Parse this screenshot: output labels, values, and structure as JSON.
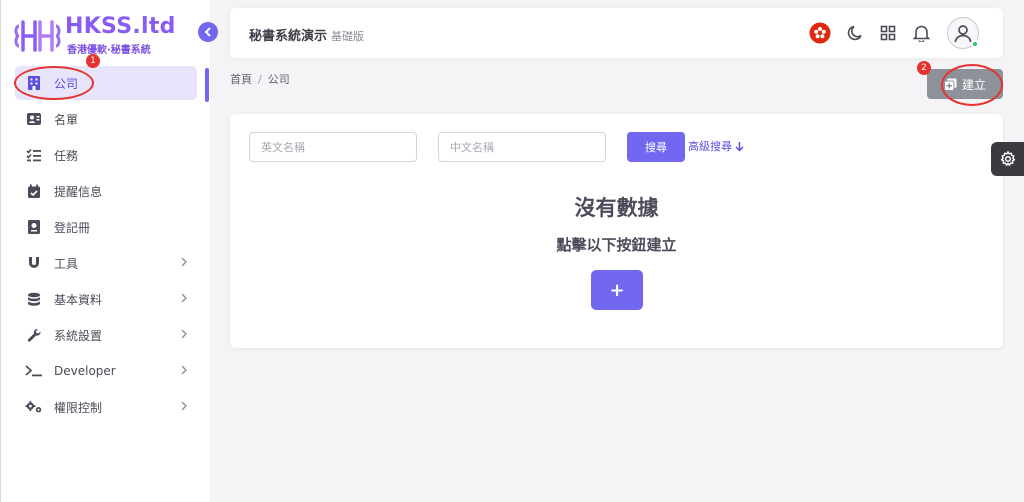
{
  "brand": {
    "title": "HKSS.ltd",
    "subtitle": "香港優軟·秘書系統",
    "primary": "#7367f0",
    "logo_color": "#8a5cf5"
  },
  "sidebar": {
    "items": [
      {
        "label": "公司",
        "icon": "building-icon",
        "active": true
      },
      {
        "label": "名單",
        "icon": "contact-card-icon"
      },
      {
        "label": "任務",
        "icon": "checklist-icon"
      },
      {
        "label": "提醒信息",
        "icon": "calendar-check-icon"
      },
      {
        "label": "登記冊",
        "icon": "register-book-icon"
      },
      {
        "label": "工具",
        "icon": "magnet-icon",
        "has_children": true
      },
      {
        "label": "基本資料",
        "icon": "database-icon",
        "has_children": true
      },
      {
        "label": "系統設置",
        "icon": "wrench-icon",
        "has_children": true
      },
      {
        "label": "Developer",
        "icon": "terminal-icon",
        "has_children": true
      },
      {
        "label": "權限控制",
        "icon": "gears-icon",
        "has_children": true
      }
    ]
  },
  "header": {
    "title": "秘書系統演示",
    "edition": "基礎版",
    "icons": [
      "hk-flag-icon",
      "moon-icon",
      "grid-icon",
      "bell-icon",
      "user-avatar-icon"
    ]
  },
  "breadcrumb": {
    "home": "首頁",
    "separator": "/",
    "current": "公司"
  },
  "toolbar": {
    "create_label": "建立"
  },
  "filters": {
    "english_name_placeholder": "英文名稱",
    "chinese_name_placeholder": "中文名稱",
    "search_label": "搜尋",
    "advanced_label": "高級搜尋"
  },
  "empty_state": {
    "title": "沒有數據",
    "subtitle": "點擊以下按鈕建立",
    "add_symbol": "+"
  },
  "annotations": {
    "marker_1": "1",
    "marker_2": "2",
    "color": "#e5332f"
  }
}
